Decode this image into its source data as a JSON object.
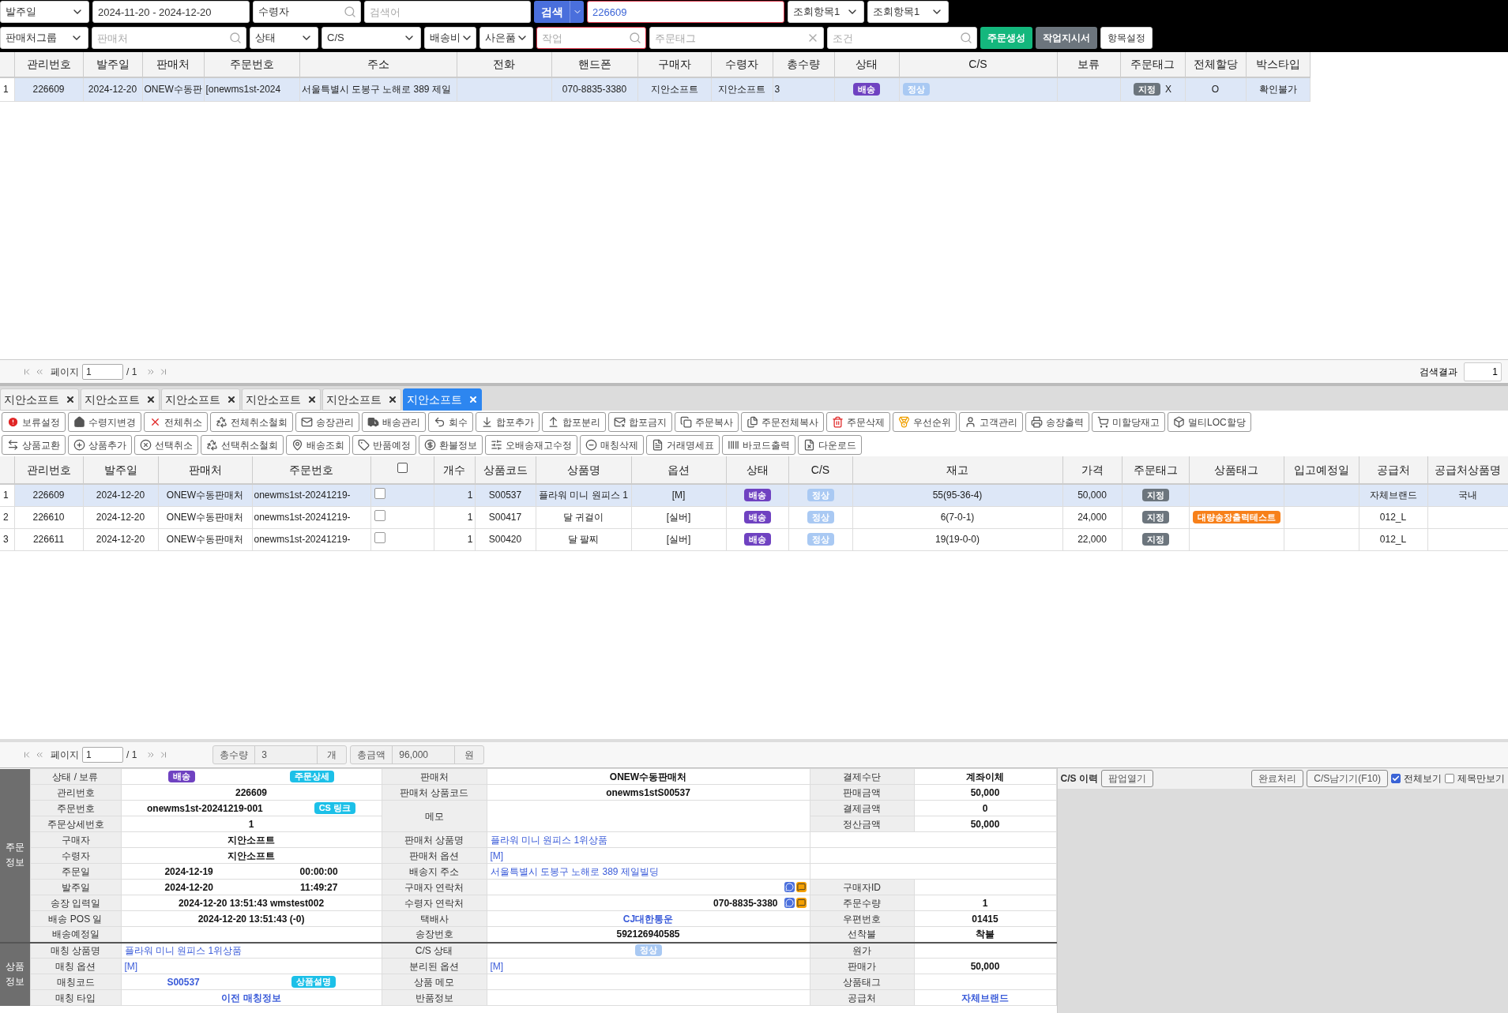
{
  "filters": {
    "row1": [
      {
        "kind": "select",
        "text": "발주일"
      },
      {
        "kind": "field",
        "value": "2024-11-20 - 2024-12-20",
        "highlighted": false
      },
      {
        "kind": "search",
        "value": "수령자",
        "highlighted": false
      },
      {
        "kind": "field",
        "placeholder": "검색어",
        "highlighted": false
      },
      {
        "kind": "split_button",
        "text": "검색"
      },
      {
        "kind": "field",
        "value": "226609",
        "highlighted": true
      },
      {
        "kind": "select",
        "text": "조회항목1"
      },
      {
        "kind": "select",
        "text": "조회항목1"
      }
    ],
    "row2": [
      {
        "kind": "select",
        "text": "판매처그룹"
      },
      {
        "kind": "search",
        "placeholder": "판매처",
        "highlighted": false
      },
      {
        "kind": "select",
        "text": "상태"
      },
      {
        "kind": "select",
        "text": "C/S"
      },
      {
        "kind": "select",
        "text": "배송비"
      },
      {
        "kind": "select",
        "text": "사은품"
      },
      {
        "kind": "search",
        "placeholder": "작업",
        "highlighted": true
      },
      {
        "kind": "clear",
        "placeholder": "주문태그",
        "highlighted": false
      },
      {
        "kind": "search",
        "placeholder": "조건",
        "highlighted": false
      },
      {
        "kind": "button",
        "text": "주문생성",
        "color": "#14b77d"
      },
      {
        "kind": "button",
        "text": "작업지시서",
        "color": "#6c757d"
      },
      {
        "kind": "plain_button",
        "text": "항목설정"
      }
    ]
  },
  "orders": {
    "columns": [
      "관리번호",
      "발주일",
      "판매처",
      "주문번호",
      "주소",
      "전화",
      "핸드폰",
      "구매자",
      "수령자",
      "총수량",
      "상태",
      "C/S",
      "보류",
      "주문태그",
      "전체할당",
      "박스타입"
    ],
    "rows": [
      {
        "number": "1",
        "selected": true,
        "cells": [
          {
            "text": "226609"
          },
          {
            "text": "2024-12-20"
          },
          {
            "text": "ONEW수동판"
          },
          {
            "text": "[onewms1st-2024"
          },
          {
            "text": "서울특별시 도봉구 노해로 389 제일"
          },
          {},
          {
            "text": "070-8835-3380"
          },
          {
            "text": "지안소프트"
          },
          {
            "text": "지안소프트"
          },
          {
            "text": "3"
          },
          {
            "badge": "배송",
            "color": "#6f42c1"
          },
          {
            "badge": "정상",
            "color": "#a9c9f3"
          },
          {},
          {
            "badge": "지정",
            "color": "#6c757d",
            "text": "X"
          },
          {
            "text": "O"
          },
          {
            "text": "확인불가"
          }
        ]
      }
    ]
  },
  "orders_pager": {
    "page_label": "페이지",
    "page": "1",
    "total": "/ 1",
    "result_label": "검색결과",
    "result": "1"
  },
  "tabs": [
    {
      "label": "지안소프트",
      "selected": false
    },
    {
      "label": "지안소프트",
      "selected": false
    },
    {
      "label": "지안소프트",
      "selected": false
    },
    {
      "label": "지안소프트",
      "selected": false
    },
    {
      "label": "지안소프트",
      "selected": false
    },
    {
      "label": "지안소프트",
      "selected": true
    }
  ],
  "actions": {
    "row1": [
      "보류설정",
      "수령지변경",
      "전체취소",
      "전체취소철회",
      "송장관리",
      "배송관리",
      "회수",
      "합포추가",
      "합포분리",
      "합포금지",
      "주문복사",
      "주문전체복사",
      "주문삭제",
      "우선순위",
      "고객관리",
      "송장출력",
      "미할당재고",
      "멀티LOC할당"
    ],
    "row2": [
      "상품교환",
      "상품추가",
      "선택취소",
      "선택취소철회",
      "배송조회",
      "반품예정",
      "환불정보",
      "오배송재고수정",
      "매칭삭제",
      "거래명세표",
      "바코드출력",
      "다운로드"
    ]
  },
  "items": {
    "columns": [
      {
        "kind": "text",
        "label": "관리번호"
      },
      {
        "kind": "text",
        "label": "발주일"
      },
      {
        "kind": "text",
        "label": "판매처"
      },
      {
        "kind": "text",
        "label": "주문번호"
      },
      {
        "kind": "checkbox",
        "checked": false
      },
      {
        "kind": "text",
        "label": "개수"
      },
      {
        "kind": "text",
        "label": "상품코드"
      },
      {
        "kind": "text",
        "label": "상품명"
      },
      {
        "kind": "text",
        "label": "옵션"
      },
      {
        "kind": "text",
        "label": "상태"
      },
      {
        "kind": "text",
        "label": "C/S"
      },
      {
        "kind": "text",
        "label": "재고"
      },
      {
        "kind": "text",
        "label": "가격"
      },
      {
        "kind": "text",
        "label": "주문태그"
      },
      {
        "kind": "text",
        "label": "상품태그"
      },
      {
        "kind": "text",
        "label": "입고예정일"
      },
      {
        "kind": "text",
        "label": "공급처"
      },
      {
        "kind": "text",
        "label": "공급처상품명"
      }
    ],
    "rows": [
      {
        "number": "1",
        "selected": true,
        "cells": [
          {
            "text": "226609"
          },
          {
            "text": "2024-12-20"
          },
          {
            "text": "ONEW수동판매처"
          },
          {
            "text": "onewms1st-20241219-"
          },
          {
            "checked": false
          },
          {
            "text": "1"
          },
          {
            "text": "S00537"
          },
          {
            "text": "플라워 미니 원피스 1"
          },
          {
            "text": "[M]"
          },
          {
            "badge": "배송",
            "color": "#6f42c1"
          },
          {
            "badge": "정상",
            "color": "#a9c9f3"
          },
          {
            "text": "55(95-36-4)"
          },
          {
            "text": "50,000"
          },
          {
            "badge": "지정",
            "color": "#6c757d"
          },
          {},
          {},
          {
            "text": "자체브랜드"
          },
          {
            "text": "국내"
          }
        ]
      },
      {
        "number": "2",
        "selected": false,
        "cells": [
          {
            "text": "226610"
          },
          {
            "text": "2024-12-20"
          },
          {
            "text": "ONEW수동판매처"
          },
          {
            "text": "onewms1st-20241219-"
          },
          {
            "checked": false
          },
          {
            "text": "1"
          },
          {
            "text": "S00417"
          },
          {
            "text": "달 귀걸이"
          },
          {
            "text": "[실버]"
          },
          {
            "badge": "배송",
            "color": "#6f42c1"
          },
          {
            "badge": "정상",
            "color": "#a9c9f3"
          },
          {
            "text": "6(7-0-1)"
          },
          {
            "text": "24,000"
          },
          {
            "badge": "지정",
            "color": "#6c757d"
          },
          {
            "badge": "대량송장출력테스트",
            "color": "#f7801a"
          },
          {},
          {
            "text": "012_L"
          },
          {}
        ]
      },
      {
        "number": "3",
        "selected": false,
        "cells": [
          {
            "text": "226611"
          },
          {
            "text": "2024-12-20"
          },
          {
            "text": "ONEW수동판매처"
          },
          {
            "text": "onewms1st-20241219-"
          },
          {
            "checked": false
          },
          {
            "text": "1"
          },
          {
            "text": "S00420"
          },
          {
            "text": "달 팔찌"
          },
          {
            "text": "[실버]"
          },
          {
            "badge": "배송",
            "color": "#6f42c1"
          },
          {
            "badge": "정상",
            "color": "#a9c9f3"
          },
          {
            "text": "19(19-0-0)"
          },
          {
            "text": "22,000"
          },
          {
            "badge": "지정",
            "color": "#6c757d"
          },
          {},
          {},
          {
            "text": "012_L"
          },
          {}
        ]
      }
    ]
  },
  "items_pager": {
    "page_label": "페이지",
    "page": "1",
    "total": "/ 1",
    "summary": [
      {
        "label": "총수량",
        "value": "3",
        "unit": "개"
      },
      {
        "label": "총금액",
        "value": "96,000",
        "unit": "원"
      }
    ]
  },
  "detail": {
    "groups": [
      {
        "label": "주문정보",
        "rows": [
          {
            "cells": [
              {
                "kind": "pair",
                "label": "상태 / 보류",
                "items": [
                  {
                    "kind": "badge",
                    "text": "배송",
                    "color": "#6f42c1"
                  },
                  {
                    "kind": "badge",
                    "text": "주문상세",
                    "color": "#1cc0e8"
                  }
                ]
              },
              {
                "kind": "pair",
                "label": "판매처",
                "items": [
                  {
                    "kind": "bold",
                    "text": "ONEW수동판매처"
                  }
                ]
              },
              {
                "kind": "pair",
                "label": "결제수단",
                "items": [
                  {
                    "kind": "bold",
                    "text": "계좌이체"
                  }
                ]
              }
            ]
          },
          {
            "cells": [
              {
                "kind": "pair",
                "label": "관리번호",
                "items": [
                  {
                    "kind": "bold",
                    "text": "226609"
                  }
                ]
              },
              {
                "kind": "pair",
                "label": "판매처 상품코드",
                "items": [
                  {
                    "kind": "bold",
                    "text": "onewms1stS00537"
                  }
                ]
              },
              {
                "kind": "pair",
                "label": "판매금액",
                "items": [
                  {
                    "kind": "bold",
                    "text": "50,000"
                  }
                ]
              }
            ]
          },
          {
            "cells": [
              {
                "kind": "pair",
                "label": "주문번호",
                "items": [
                  {
                    "kind": "bold",
                    "text": "onewms1st-20241219-001"
                  },
                  {
                    "kind": "badge",
                    "text": "CS 링크",
                    "color": "#1cc0e8"
                  }
                ]
              },
              {
                "kind": "pair",
                "label": "메모",
                "rowspan": 2
              },
              {
                "kind": "pair",
                "label": "결제금액",
                "items": [
                  {
                    "kind": "bold",
                    "text": "0"
                  }
                ]
              }
            ]
          },
          {
            "cells": [
              {
                "kind": "pair",
                "label": "주문상세번호",
                "items": [
                  {
                    "kind": "bold",
                    "text": "1"
                  }
                ]
              },
              {
                "kind": "pair",
                "label": "정산금액",
                "items": [
                  {
                    "kind": "bold",
                    "text": "50,000"
                  }
                ]
              }
            ]
          },
          {
            "cells": [
              {
                "kind": "pair",
                "label": "구매자",
                "items": [
                  {
                    "kind": "bold",
                    "text": "지안소프트"
                  }
                ]
              },
              {
                "kind": "pair",
                "label": "판매처 상품명",
                "items": [
                  {
                    "kind": "link",
                    "text": "플라워 미니 원피스 1위상품"
                  }
                ]
              },
              {
                "kind": "blank"
              }
            ]
          },
          {
            "cells": [
              {
                "kind": "pair",
                "label": "수령자",
                "items": [
                  {
                    "kind": "bold",
                    "text": "지안소프트"
                  }
                ]
              },
              {
                "kind": "pair",
                "label": "판매처 옵션",
                "items": [
                  {
                    "kind": "link",
                    "text": "[M]"
                  }
                ]
              },
              {
                "kind": "blank"
              }
            ]
          },
          {
            "cells": [
              {
                "kind": "pair",
                "label": "주문일",
                "items": [
                  {
                    "kind": "bold",
                    "text": "2024-12-19"
                  },
                  {
                    "kind": "bold",
                    "text": "00:00:00"
                  }
                ]
              },
              {
                "kind": "pair",
                "label": "배송지 주소",
                "items": [
                  {
                    "kind": "link",
                    "text": "서울특별시 도봉구 노해로 389 제일빌딩"
                  }
                ]
              },
              {
                "kind": "blank"
              }
            ]
          },
          {
            "cells": [
              {
                "kind": "pair",
                "label": "발주일",
                "items": [
                  {
                    "kind": "bold",
                    "text": "2024-12-20"
                  },
                  {
                    "kind": "bold",
                    "text": "11:49:27"
                  }
                ]
              },
              {
                "kind": "pair",
                "label": "구매자 연락처",
                "items": [
                  {
                    "kind": "icons"
                  }
                ]
              },
              {
                "kind": "pair",
                "label": "구매자ID"
              }
            ]
          },
          {
            "cells": [
              {
                "kind": "pair",
                "label": "송장 입력일",
                "items": [
                  {
                    "kind": "bold",
                    "text": "2024-12-20 13:51:43 wmstest002"
                  }
                ]
              },
              {
                "kind": "pair",
                "label": "수령자 연락처",
                "items": [
                  {
                    "kind": "bold",
                    "text": "070-8835-3380"
                  },
                  {
                    "kind": "icons"
                  }
                ]
              },
              {
                "kind": "pair",
                "label": "주문수량",
                "items": [
                  {
                    "kind": "bold",
                    "text": "1"
                  }
                ]
              }
            ]
          },
          {
            "cells": [
              {
                "kind": "pair",
                "label": "배송 POS 일",
                "items": [
                  {
                    "kind": "bold",
                    "text": "2024-12-20 13:51:43 (-0)"
                  }
                ]
              },
              {
                "kind": "pair",
                "label": "택배사",
                "items": [
                  {
                    "kind": "accent",
                    "text": "CJ대한통운"
                  }
                ]
              },
              {
                "kind": "pair",
                "label": "우편번호",
                "items": [
                  {
                    "kind": "bold",
                    "text": "01415"
                  }
                ]
              }
            ]
          },
          {
            "cells": [
              {
                "kind": "pair",
                "label": "배송예정일"
              },
              {
                "kind": "pair",
                "label": "송장번호",
                "items": [
                  {
                    "kind": "bold",
                    "text": "592126940585"
                  }
                ]
              },
              {
                "kind": "pair",
                "label": "선착불",
                "items": [
                  {
                    "kind": "bold",
                    "text": "착불"
                  }
                ]
              }
            ]
          }
        ]
      },
      {
        "label": "상품정보",
        "rows": [
          {
            "cells": [
              {
                "kind": "pair",
                "label": "매칭 상품명",
                "items": [
                  {
                    "kind": "link",
                    "text": "플라워 미니 원피스 1위상품"
                  }
                ]
              },
              {
                "kind": "pair",
                "label": "C/S 상태",
                "items": [
                  {
                    "kind": "badge",
                    "text": "정상",
                    "color": "#a9c9f3"
                  }
                ]
              },
              {
                "kind": "pair",
                "label": "원가"
              }
            ]
          },
          {
            "cells": [
              {
                "kind": "pair",
                "label": "매칭 옵션",
                "items": [
                  {
                    "kind": "link",
                    "text": "[M]"
                  }
                ]
              },
              {
                "kind": "pair",
                "label": "분리된 옵션",
                "items": [
                  {
                    "kind": "link",
                    "text": "[M]"
                  }
                ]
              },
              {
                "kind": "pair",
                "label": "판매가",
                "items": [
                  {
                    "kind": "bold",
                    "text": "50,000"
                  }
                ]
              }
            ]
          },
          {
            "cells": [
              {
                "kind": "pair",
                "label": "매칭코드",
                "items": [
                  {
                    "kind": "accent",
                    "text": "S00537"
                  },
                  {
                    "kind": "badge",
                    "text": "상품설명",
                    "color": "#1cc0e8"
                  }
                ]
              },
              {
                "kind": "pair",
                "label": "상품 메모"
              },
              {
                "kind": "pair",
                "label": "상품태그"
              }
            ]
          },
          {
            "cells": [
              {
                "kind": "pair",
                "label": "매칭 타입",
                "items": [
                  {
                    "kind": "accent",
                    "text": "이전 매칭정보"
                  }
                ]
              },
              {
                "kind": "pair",
                "label": "반품정보"
              },
              {
                "kind": "pair",
                "label": "공급처",
                "items": [
                  {
                    "kind": "accent",
                    "text": "자체브랜드"
                  }
                ]
              }
            ]
          }
        ]
      }
    ]
  },
  "cs_panel": {
    "title": "C/S 이력",
    "popup": "팝업열기",
    "buttons": [
      "완료처리",
      "C/S남기기(F10)"
    ],
    "options": [
      {
        "label": "전체보기",
        "checked": true
      },
      {
        "label": "제목만보기",
        "checked": false
      }
    ]
  }
}
